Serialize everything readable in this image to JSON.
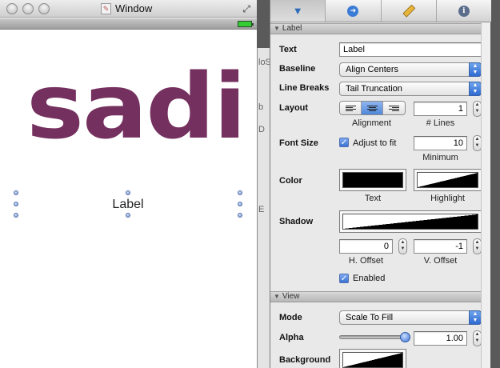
{
  "window": {
    "title": "Window"
  },
  "canvas": {
    "big_text": "sadi",
    "big_text_color": "#74305e",
    "selected_label": "Label"
  },
  "ghost_text": [
    "loS",
    "b",
    "D",
    "E"
  ],
  "inspector": {
    "tabs": [
      "inspector-icon",
      "arrow-icon",
      "ruler-icon",
      "info-icon"
    ],
    "label_section": "Label",
    "text_label": "Text",
    "text_value": "Label",
    "baseline_label": "Baseline",
    "baseline_value": "Align Centers",
    "linebreaks_label": "Line Breaks",
    "linebreaks_value": "Tail Truncation",
    "layout_label": "Layout",
    "lines_value": "1",
    "alignment_caption": "Alignment",
    "lines_caption": "# Lines",
    "fontsize_label": "Font Size",
    "adjust_label": "Adjust to fit",
    "minimum_value": "10",
    "minimum_caption": "Minimum",
    "color_label": "Color",
    "text_caption": "Text",
    "highlight_caption": "Highlight",
    "shadow_label": "Shadow",
    "h_offset_value": "0",
    "v_offset_value": "-1",
    "h_offset_caption": "H. Offset",
    "v_offset_caption": "V. Offset",
    "enabled_label": "Enabled",
    "view_section": "View",
    "mode_label": "Mode",
    "mode_value": "Scale To Fill",
    "alpha_label": "Alpha",
    "alpha_value": "1.00",
    "alpha_fraction": 1.0,
    "background_label": "Background"
  }
}
